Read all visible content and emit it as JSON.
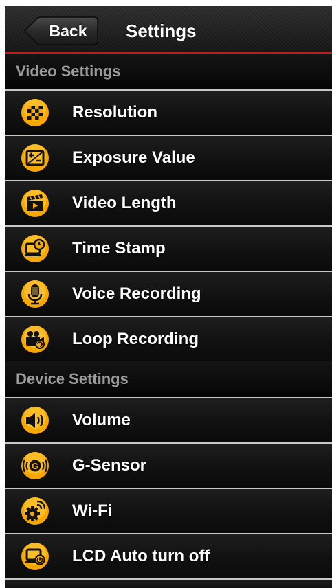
{
  "navbar": {
    "back_label": "Back",
    "title": "Settings",
    "accent_color": "#d21414"
  },
  "sections": [
    {
      "header": "Video Settings",
      "items": [
        {
          "label": "Resolution",
          "icon": "resolution-icon"
        },
        {
          "label": "Exposure Value",
          "icon": "exposure-icon"
        },
        {
          "label": "Video Length",
          "icon": "clapperboard-icon"
        },
        {
          "label": "Time Stamp",
          "icon": "time-stamp-icon"
        },
        {
          "label": "Voice Recording",
          "icon": "microphone-icon"
        },
        {
          "label": "Loop Recording",
          "icon": "loop-camera-icon"
        }
      ]
    },
    {
      "header": "Device Settings",
      "items": [
        {
          "label": "Volume",
          "icon": "speaker-icon"
        },
        {
          "label": "G-Sensor",
          "icon": "g-sensor-icon"
        },
        {
          "label": "Wi-Fi",
          "icon": "wifi-gear-icon"
        },
        {
          "label": "LCD Auto turn off",
          "icon": "lcd-power-icon"
        },
        {
          "label": "",
          "icon": "partial-icon"
        }
      ]
    }
  ],
  "icon_color": "#f7a800"
}
